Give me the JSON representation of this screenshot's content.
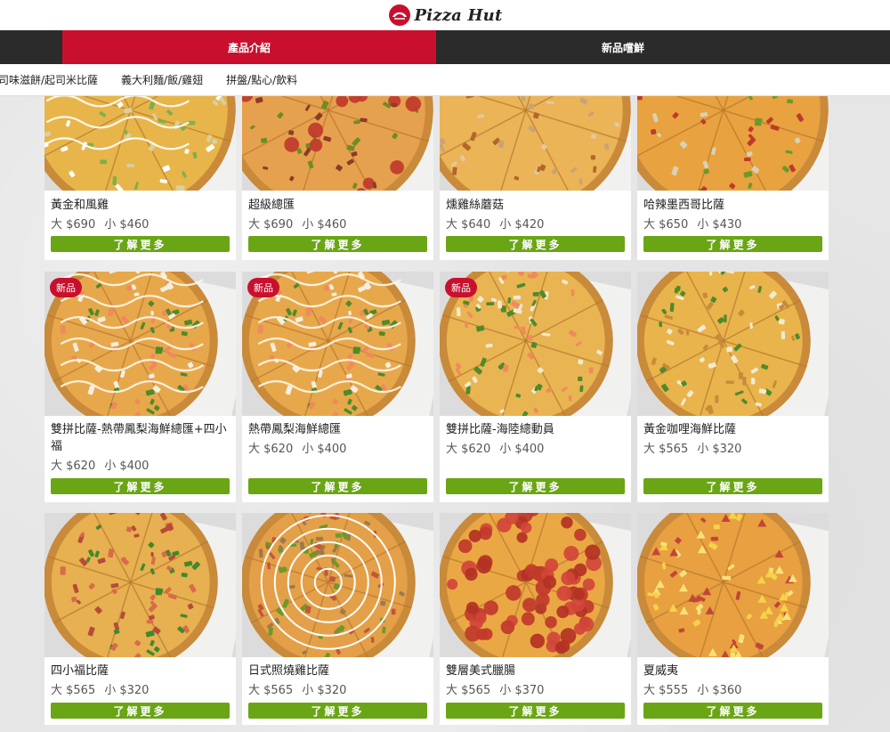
{
  "brand": {
    "logo_text": "Pizza Hut"
  },
  "main_nav": [
    {
      "label": "產品介紹",
      "active": true
    },
    {
      "label": "新品嚐鮮",
      "active": false
    }
  ],
  "sub_nav": [
    "司味滋餅/起司米比薩",
    "義大利麵/飯/雞翅",
    "拼盤/點心/飲料"
  ],
  "colors": {
    "brand_red": "#c8102e",
    "button_green": "#6aa516",
    "nav_dark": "#2b2b2b"
  },
  "more_label": "了解更多",
  "products": [
    {
      "name": "黃金和風雞",
      "large": "大 $690",
      "small": "小 $460",
      "badge": "",
      "style": "wafu"
    },
    {
      "name": "超級總匯",
      "large": "大 $690",
      "small": "小 $460",
      "badge": "",
      "style": "supreme"
    },
    {
      "name": "燻雞絲蘑菇",
      "large": "大 $640",
      "small": "小 $420",
      "badge": "",
      "style": "mushroom"
    },
    {
      "name": "哈辣墨西哥比薩",
      "large": "大 $650",
      "small": "小 $430",
      "badge": "",
      "style": "mexican"
    },
    {
      "name": "雙拼比薩-熱帶鳳梨海鮮總匯+四小福",
      "large": "大 $620",
      "small": "小 $400",
      "badge": "新品",
      "style": "seafood"
    },
    {
      "name": "熱帶鳳梨海鮮總匯",
      "large": "大 $620",
      "small": "小 $400",
      "badge": "新品",
      "style": "seafood"
    },
    {
      "name": "雙拼比薩-海陸總動員",
      "large": "大 $620",
      "small": "小 $400",
      "badge": "新品",
      "style": "surfturf"
    },
    {
      "name": "黃金咖哩海鮮比薩",
      "large": "大 $565",
      "small": "小 $320",
      "badge": "",
      "style": "curry"
    },
    {
      "name": "四小福比薩",
      "large": "大 $565",
      "small": "小 $320",
      "badge": "",
      "style": "fourjoy"
    },
    {
      "name": "日式照燒雞比薩",
      "large": "大 $565",
      "small": "小 $320",
      "badge": "",
      "style": "teriyaki"
    },
    {
      "name": "雙層美式臘腸",
      "large": "大 $565",
      "small": "小 $370",
      "badge": "",
      "style": "pepperoni"
    },
    {
      "name": "夏威夷",
      "large": "大 $555",
      "small": "小 $360",
      "badge": "",
      "style": "hawaiian"
    }
  ]
}
